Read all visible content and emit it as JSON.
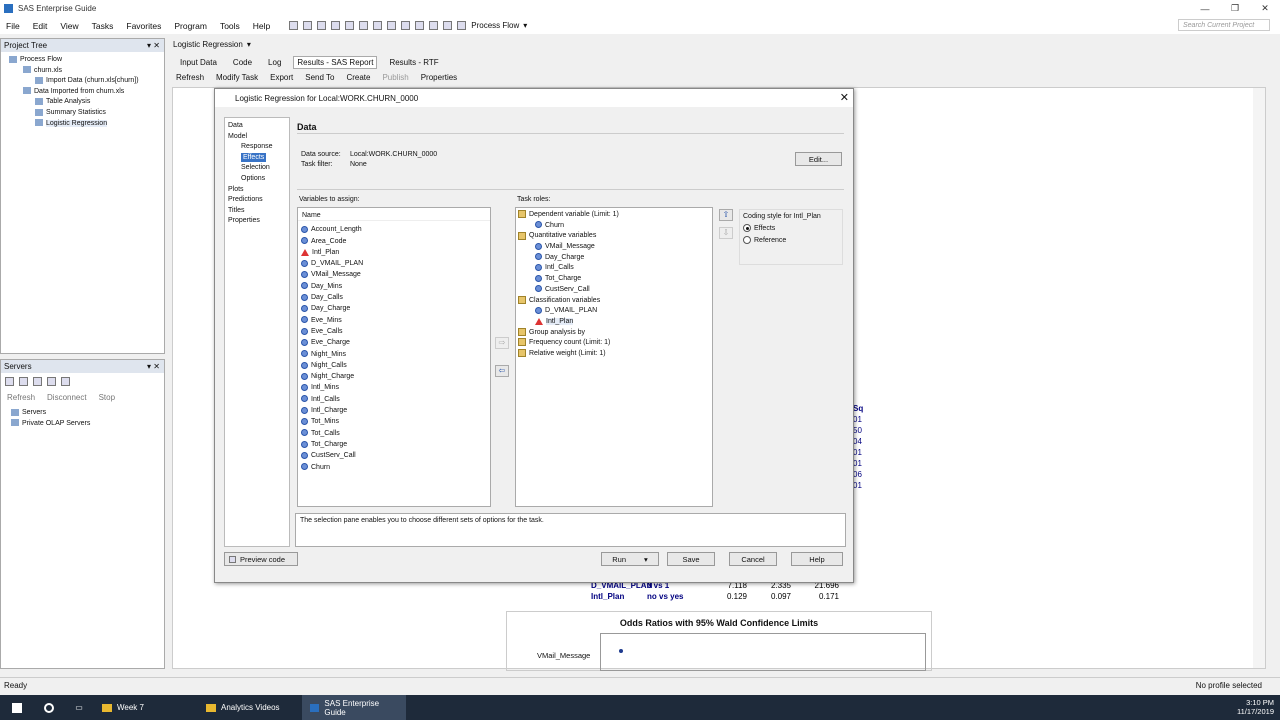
{
  "window": {
    "title": "SAS Enterprise Guide",
    "min": "—",
    "max": "❐",
    "close": "✕"
  },
  "menu": [
    "File",
    "Edit",
    "View",
    "Tasks",
    "Favorites",
    "Program",
    "Tools",
    "Help"
  ],
  "toolbar": {
    "process_flow": "Process Flow",
    "search_placeholder": "Search Current Project"
  },
  "project_tree": {
    "title": "Project Tree",
    "items": [
      "Process Flow",
      "churn.xls",
      "Import Data (churn.xls[churn])",
      "Data Imported from churn.xls",
      "Table Analysis",
      "Summary Statistics",
      "Logistic Regression"
    ]
  },
  "servers": {
    "title": "Servers",
    "refresh": "Refresh",
    "disconnect": "Disconnect",
    "stop": "Stop",
    "items": [
      "Servers",
      "Private OLAP Servers"
    ]
  },
  "doc_tab": "Logistic Regression",
  "subtabs": [
    "Input Data",
    "Code",
    "Log",
    "Results - SAS Report",
    "Results - RTF"
  ],
  "actions": [
    "Refresh",
    "Modify Task",
    "Export",
    "Send To",
    "Create",
    "Publish",
    "Properties"
  ],
  "background": {
    "sq_header": "Sq",
    "sq_values": [
      "01",
      "50",
      "04",
      "01",
      "01",
      "06",
      "01"
    ],
    "rows": [
      {
        "label": "D_VMAIL_PLAN",
        "comp": "0 vs 1",
        "est": "7.118",
        "low": "2.335",
        "high": "21.696"
      },
      {
        "label": "Intl_Plan",
        "comp": "no vs yes",
        "est": "0.129",
        "low": "0.097",
        "high": "0.171"
      }
    ],
    "odds_title": "Odds Ratios with 95% Wald Confidence Limits",
    "odds_label": "VMail_Message"
  },
  "dialog": {
    "title": "Logistic Regression  for Local:WORK.CHURN_0000",
    "nav": [
      "Data",
      "Model",
      "Response",
      "Effects",
      "Selection",
      "Options",
      "Plots",
      "Predictions",
      "Titles",
      "Properties"
    ],
    "heading": "Data",
    "source_label": "Data source:",
    "source_value": "Local:WORK.CHURN_0000",
    "filter_label": "Task filter:",
    "filter_value": "None",
    "edit": "Edit...",
    "vars_label": "Variables to assign:",
    "vars_header": "Name",
    "variables": [
      "Account_Length",
      "Area_Code",
      "Intl_Plan",
      "D_VMAIL_PLAN",
      "VMail_Message",
      "Day_Mins",
      "Day_Calls",
      "Day_Charge",
      "Eve_Mins",
      "Eve_Calls",
      "Eve_Charge",
      "Night_Mins",
      "Night_Calls",
      "Night_Charge",
      "Intl_Mins",
      "Intl_Calls",
      "Intl_Charge",
      "Tot_Mins",
      "Tot_Calls",
      "Tot_Charge",
      "CustServ_Call",
      "Churn"
    ],
    "roles_label": "Task roles:",
    "roles": {
      "dep": "Dependent variable  (Limit: 1)",
      "dep_items": [
        "Churn"
      ],
      "quant": "Quantitative variables",
      "quant_items": [
        "VMail_Message",
        "Day_Charge",
        "Intl_Calls",
        "Tot_Charge",
        "CustServ_Call"
      ],
      "class": "Classification variables",
      "class_items": [
        "D_VMAIL_PLAN",
        "Intl_Plan"
      ],
      "group": "Group analysis by",
      "freq": "Frequency count  (Limit: 1)",
      "weight": "Relative weight  (Limit: 1)"
    },
    "coding_label": "Coding style for Intl_Plan",
    "coding_effects": "Effects",
    "coding_reference": "Reference",
    "help_text": "The selection pane enables you to choose different sets of options for the task.",
    "preview": "Preview code",
    "run": "Run",
    "save": "Save",
    "cancel": "Cancel",
    "help": "Help"
  },
  "status": {
    "left": "Ready",
    "right": "No profile selected"
  },
  "taskbar": {
    "items": [
      "Week 7",
      "Analytics Videos",
      "SAS Enterprise Guide"
    ],
    "time": "3:10 PM",
    "date": "11/17/2019"
  }
}
